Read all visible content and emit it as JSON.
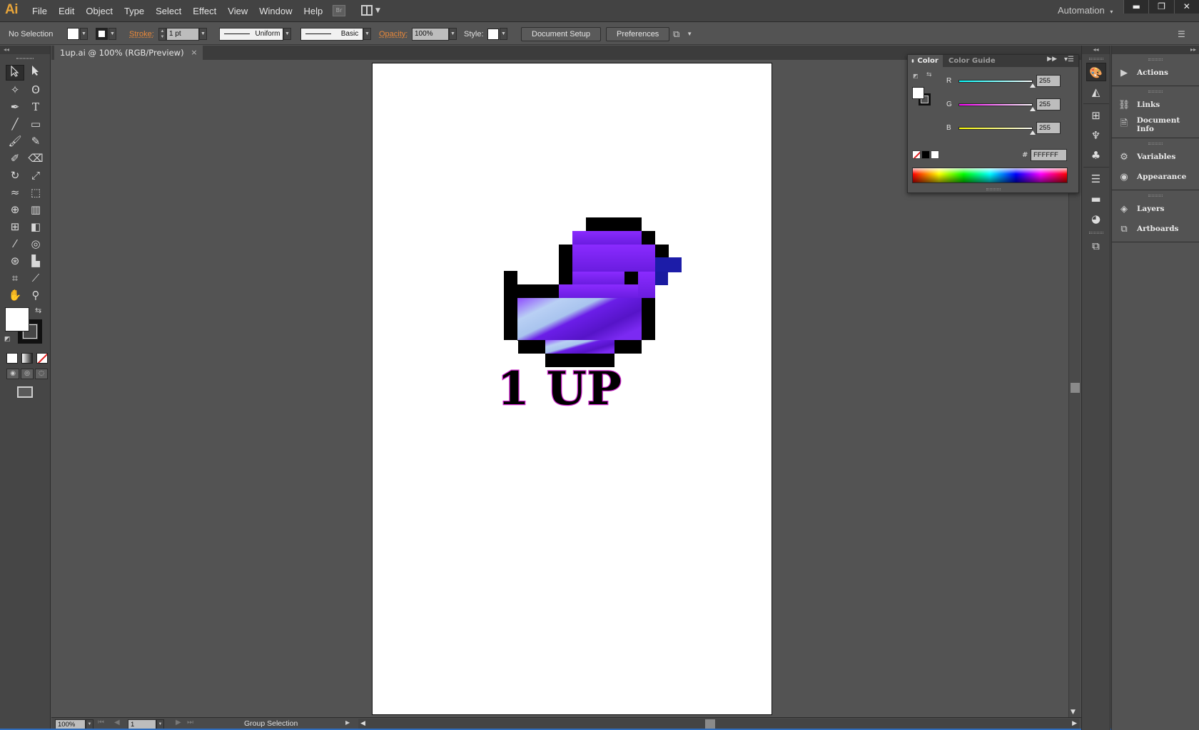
{
  "app": {
    "logo": "Ai"
  },
  "menu": {
    "items": [
      "File",
      "Edit",
      "Object",
      "Type",
      "Select",
      "Effect",
      "View",
      "Window",
      "Help"
    ],
    "bridge_label": "Br",
    "workspace": "Automation",
    "window_controls": {
      "minimize": "▬",
      "restore": "❐",
      "close": "✕"
    }
  },
  "control_bar": {
    "selection": "No Selection",
    "stroke_label": "Stroke:",
    "stroke_weight": "1 pt",
    "variable_width": "Uniform",
    "brush": "Basic",
    "opacity_label": "Opacity:",
    "opacity_value": "100%",
    "style_label": "Style:",
    "document_setup": "Document Setup",
    "preferences": "Preferences"
  },
  "document": {
    "tab_title": "1up.ai @ 100% (RGB/Preview)",
    "close_glyph": "×"
  },
  "artwork": {
    "text": "1 UP",
    "colors": {
      "body": "#7b24f5",
      "outline": "#000000",
      "beak": "#1c1ca8",
      "highlight": "#a9c6f0",
      "text_stroke": "#cc22cc"
    }
  },
  "status_bar": {
    "zoom": "100%",
    "page": "1",
    "tool_status": "Group Selection"
  },
  "color_panel": {
    "tab_color": "Color",
    "tab_guide": "Color Guide",
    "channels": [
      {
        "label": "R",
        "value": "255",
        "gradient": "linear-gradient(to right,#00ffff,#ffffff)"
      },
      {
        "label": "G",
        "value": "255",
        "gradient": "linear-gradient(to right,#ff00ff,#ffffff)"
      },
      {
        "label": "B",
        "value": "255",
        "gradient": "linear-gradient(to right,#ffff00,#ffffff)"
      }
    ],
    "hash": "#",
    "hex": "FFFFFF"
  },
  "dock_icons": [
    "color-icon",
    "color-guide-icon",
    "swatches-icon",
    "brushes-icon",
    "symbols-icon",
    "stroke-icon",
    "gradient-icon",
    "transparency-icon",
    "transform-icon"
  ],
  "right_panels": {
    "actions": "Actions",
    "links": "Links",
    "document_info": "Document Info",
    "variables": "Variables",
    "appearance": "Appearance",
    "layers": "Layers",
    "artboards": "Artboards"
  }
}
